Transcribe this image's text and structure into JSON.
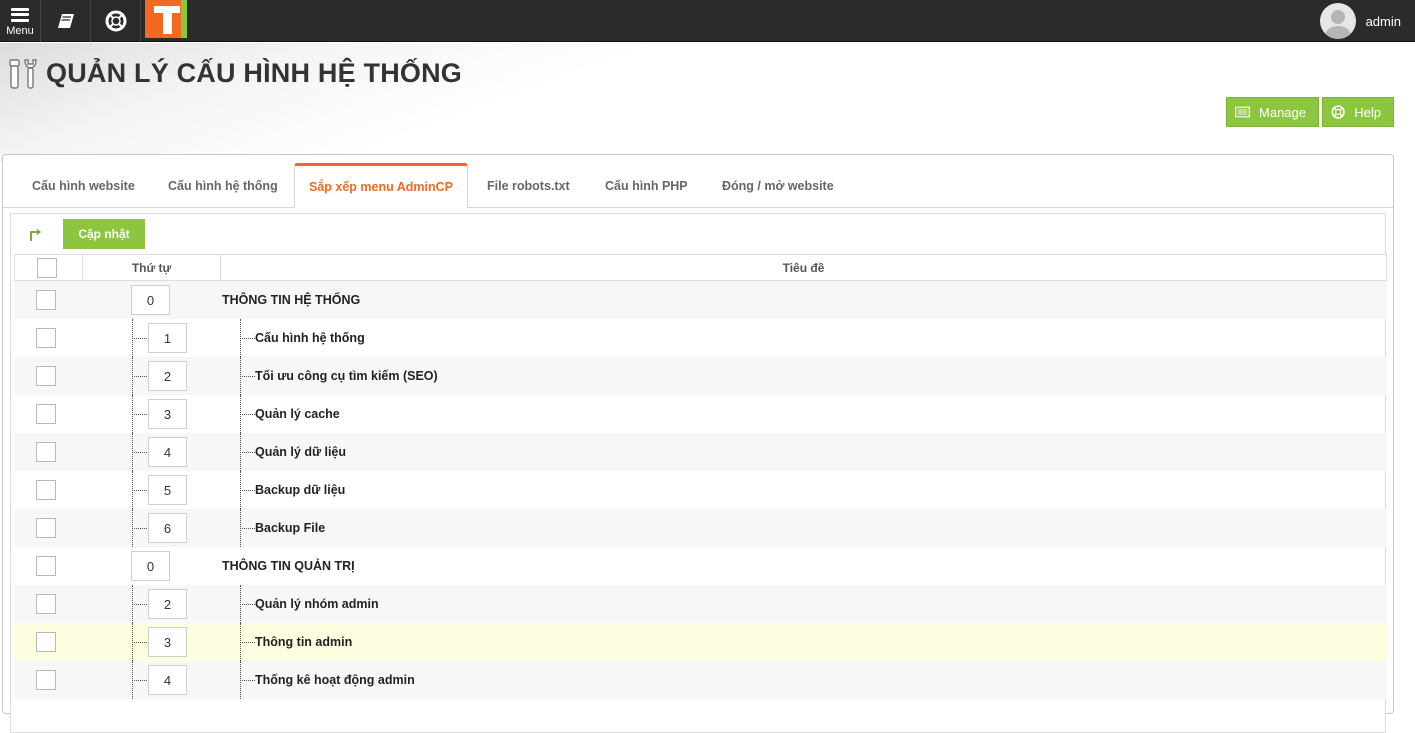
{
  "topbar": {
    "menu_label": "Menu",
    "user_name": "admin"
  },
  "header": {
    "title": "QUẢN LÝ CẤU HÌNH HỆ THỐNG",
    "manage_label": "Manage",
    "help_label": "Help"
  },
  "tabs": [
    {
      "label": "Cấu hình website",
      "active": false
    },
    {
      "label": "Cấu hình hệ thống",
      "active": false
    },
    {
      "label": "Sắp xếp menu AdminCP",
      "active": true
    },
    {
      "label": "File robots.txt",
      "active": false
    },
    {
      "label": "Cấu hình PHP",
      "active": false
    },
    {
      "label": "Đóng / mở website",
      "active": false
    }
  ],
  "toolbar": {
    "update_label": "Cập nhật"
  },
  "table": {
    "col_order": "Thứ tự",
    "col_title": "Tiêu đề",
    "rows": [
      {
        "order": "0",
        "title": "THÔNG TIN HỆ THỐNG",
        "level": 0
      },
      {
        "order": "1",
        "title": "Cấu hình hệ thống",
        "level": 1
      },
      {
        "order": "2",
        "title": "Tối ưu công cụ tìm kiếm (SEO)",
        "level": 1
      },
      {
        "order": "3",
        "title": "Quản lý cache",
        "level": 1
      },
      {
        "order": "4",
        "title": "Quản lý dữ liệu",
        "level": 1
      },
      {
        "order": "5",
        "title": "Backup dữ liệu",
        "level": 1
      },
      {
        "order": "6",
        "title": "Backup File",
        "level": 1
      },
      {
        "order": "0",
        "title": "THÔNG TIN QUẢN TRỊ",
        "level": 0
      },
      {
        "order": "2",
        "title": "Quản lý nhóm admin",
        "level": 1
      },
      {
        "order": "3",
        "title": "Thông tin admin",
        "level": 1,
        "highlighted": true
      },
      {
        "order": "4",
        "title": "Thống kê hoạt động admin",
        "level": 1
      }
    ]
  },
  "colors": {
    "accent_orange": "#f26a21",
    "accent_green": "#8cc63f",
    "topbar": "#2b2b2b"
  }
}
